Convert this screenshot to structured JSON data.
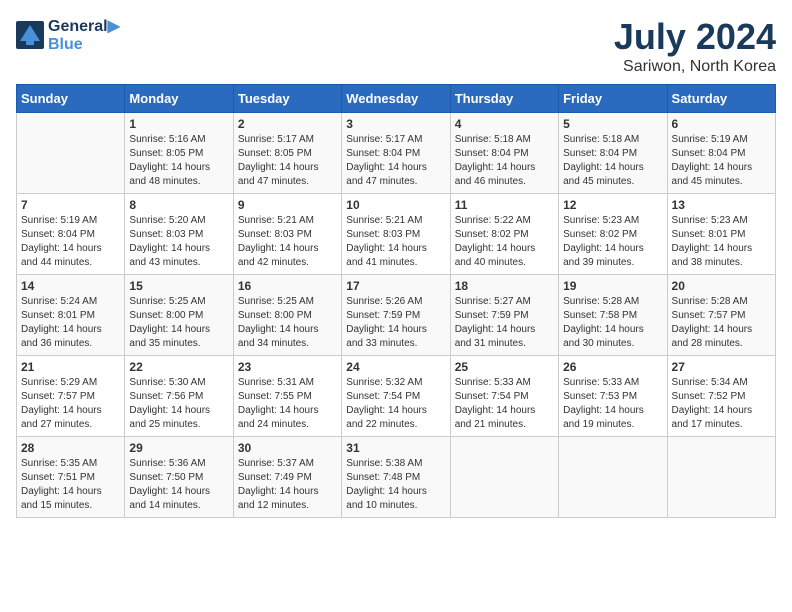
{
  "header": {
    "logo_line1": "General",
    "logo_line2": "Blue",
    "month_title": "July 2024",
    "subtitle": "Sariwon, North Korea"
  },
  "weekdays": [
    "Sunday",
    "Monday",
    "Tuesday",
    "Wednesday",
    "Thursday",
    "Friday",
    "Saturday"
  ],
  "weeks": [
    [
      {
        "day": "",
        "info": ""
      },
      {
        "day": "1",
        "info": "Sunrise: 5:16 AM\nSunset: 8:05 PM\nDaylight: 14 hours\nand 48 minutes."
      },
      {
        "day": "2",
        "info": "Sunrise: 5:17 AM\nSunset: 8:05 PM\nDaylight: 14 hours\nand 47 minutes."
      },
      {
        "day": "3",
        "info": "Sunrise: 5:17 AM\nSunset: 8:04 PM\nDaylight: 14 hours\nand 47 minutes."
      },
      {
        "day": "4",
        "info": "Sunrise: 5:18 AM\nSunset: 8:04 PM\nDaylight: 14 hours\nand 46 minutes."
      },
      {
        "day": "5",
        "info": "Sunrise: 5:18 AM\nSunset: 8:04 PM\nDaylight: 14 hours\nand 45 minutes."
      },
      {
        "day": "6",
        "info": "Sunrise: 5:19 AM\nSunset: 8:04 PM\nDaylight: 14 hours\nand 45 minutes."
      }
    ],
    [
      {
        "day": "7",
        "info": "Sunrise: 5:19 AM\nSunset: 8:04 PM\nDaylight: 14 hours\nand 44 minutes."
      },
      {
        "day": "8",
        "info": "Sunrise: 5:20 AM\nSunset: 8:03 PM\nDaylight: 14 hours\nand 43 minutes."
      },
      {
        "day": "9",
        "info": "Sunrise: 5:21 AM\nSunset: 8:03 PM\nDaylight: 14 hours\nand 42 minutes."
      },
      {
        "day": "10",
        "info": "Sunrise: 5:21 AM\nSunset: 8:03 PM\nDaylight: 14 hours\nand 41 minutes."
      },
      {
        "day": "11",
        "info": "Sunrise: 5:22 AM\nSunset: 8:02 PM\nDaylight: 14 hours\nand 40 minutes."
      },
      {
        "day": "12",
        "info": "Sunrise: 5:23 AM\nSunset: 8:02 PM\nDaylight: 14 hours\nand 39 minutes."
      },
      {
        "day": "13",
        "info": "Sunrise: 5:23 AM\nSunset: 8:01 PM\nDaylight: 14 hours\nand 38 minutes."
      }
    ],
    [
      {
        "day": "14",
        "info": "Sunrise: 5:24 AM\nSunset: 8:01 PM\nDaylight: 14 hours\nand 36 minutes."
      },
      {
        "day": "15",
        "info": "Sunrise: 5:25 AM\nSunset: 8:00 PM\nDaylight: 14 hours\nand 35 minutes."
      },
      {
        "day": "16",
        "info": "Sunrise: 5:25 AM\nSunset: 8:00 PM\nDaylight: 14 hours\nand 34 minutes."
      },
      {
        "day": "17",
        "info": "Sunrise: 5:26 AM\nSunset: 7:59 PM\nDaylight: 14 hours\nand 33 minutes."
      },
      {
        "day": "18",
        "info": "Sunrise: 5:27 AM\nSunset: 7:59 PM\nDaylight: 14 hours\nand 31 minutes."
      },
      {
        "day": "19",
        "info": "Sunrise: 5:28 AM\nSunset: 7:58 PM\nDaylight: 14 hours\nand 30 minutes."
      },
      {
        "day": "20",
        "info": "Sunrise: 5:28 AM\nSunset: 7:57 PM\nDaylight: 14 hours\nand 28 minutes."
      }
    ],
    [
      {
        "day": "21",
        "info": "Sunrise: 5:29 AM\nSunset: 7:57 PM\nDaylight: 14 hours\nand 27 minutes."
      },
      {
        "day": "22",
        "info": "Sunrise: 5:30 AM\nSunset: 7:56 PM\nDaylight: 14 hours\nand 25 minutes."
      },
      {
        "day": "23",
        "info": "Sunrise: 5:31 AM\nSunset: 7:55 PM\nDaylight: 14 hours\nand 24 minutes."
      },
      {
        "day": "24",
        "info": "Sunrise: 5:32 AM\nSunset: 7:54 PM\nDaylight: 14 hours\nand 22 minutes."
      },
      {
        "day": "25",
        "info": "Sunrise: 5:33 AM\nSunset: 7:54 PM\nDaylight: 14 hours\nand 21 minutes."
      },
      {
        "day": "26",
        "info": "Sunrise: 5:33 AM\nSunset: 7:53 PM\nDaylight: 14 hours\nand 19 minutes."
      },
      {
        "day": "27",
        "info": "Sunrise: 5:34 AM\nSunset: 7:52 PM\nDaylight: 14 hours\nand 17 minutes."
      }
    ],
    [
      {
        "day": "28",
        "info": "Sunrise: 5:35 AM\nSunset: 7:51 PM\nDaylight: 14 hours\nand 15 minutes."
      },
      {
        "day": "29",
        "info": "Sunrise: 5:36 AM\nSunset: 7:50 PM\nDaylight: 14 hours\nand 14 minutes."
      },
      {
        "day": "30",
        "info": "Sunrise: 5:37 AM\nSunset: 7:49 PM\nDaylight: 14 hours\nand 12 minutes."
      },
      {
        "day": "31",
        "info": "Sunrise: 5:38 AM\nSunset: 7:48 PM\nDaylight: 14 hours\nand 10 minutes."
      },
      {
        "day": "",
        "info": ""
      },
      {
        "day": "",
        "info": ""
      },
      {
        "day": "",
        "info": ""
      }
    ]
  ]
}
